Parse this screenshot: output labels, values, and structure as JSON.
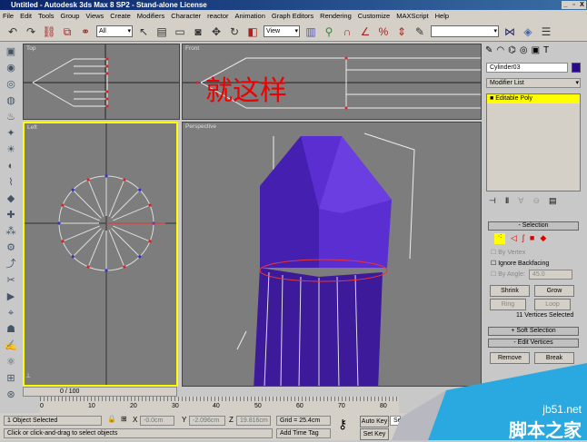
{
  "window": {
    "title": "Untitled - Autodesk 3ds Max 8 SP2  - Stand-alone License",
    "min": "_",
    "max": "▫",
    "close": "X"
  },
  "menu": [
    "File",
    "Edit",
    "Tools",
    "Group",
    "Views",
    "Create",
    "Modifiers",
    "Character",
    "reactor",
    "Animation",
    "Graph Editors",
    "Rendering",
    "Customize",
    "MAXScript",
    "Help"
  ],
  "toolbar": {
    "selection_filter": "All",
    "reference_coord": "View",
    "named_selection": ""
  },
  "viewports": {
    "top": "Top",
    "front": "Front",
    "left": "Left",
    "perspective": "Perspective",
    "annotation": "就这样"
  },
  "panel": {
    "object_name": "Cylinder03",
    "object_color": "#2a0a8c",
    "modifier_list": "Modifier List",
    "stack_item": "Editable Poly",
    "selection": {
      "title": "Selection",
      "by_vertex": "By Vertex",
      "ignore_backfacing": "Ignore Backfacing",
      "by_angle": "By Angle:",
      "angle_value": "45.0",
      "shrink": "Shrink",
      "grow": "Grow",
      "ring": "Ring",
      "loop": "Loop",
      "status": "11 Vertices Selected"
    },
    "soft_selection": "Soft Selection",
    "edit_vertices": "Edit Vertices",
    "remove": "Remove",
    "break": "Break"
  },
  "timeline": {
    "slider": "0 / 100",
    "ticks": [
      "0",
      "10",
      "20",
      "30",
      "40",
      "50",
      "60",
      "70",
      "80"
    ]
  },
  "status": {
    "selected": "1 Object Selected",
    "prompt": "Click or click-and-drag to select objects",
    "x": "-0.0cm",
    "y": "-2.096cm",
    "z": "19.816cm",
    "x_label": "X",
    "y_label": "Y",
    "z_label": "Z",
    "grid": "Grid = 25.4cm",
    "add_time_tag": "Add Time Tag",
    "auto_key": "Auto Key",
    "set_key": "Set Key",
    "key_mode": "Se"
  },
  "watermark": {
    "url": "jb51.net",
    "name": "脚本之家"
  }
}
